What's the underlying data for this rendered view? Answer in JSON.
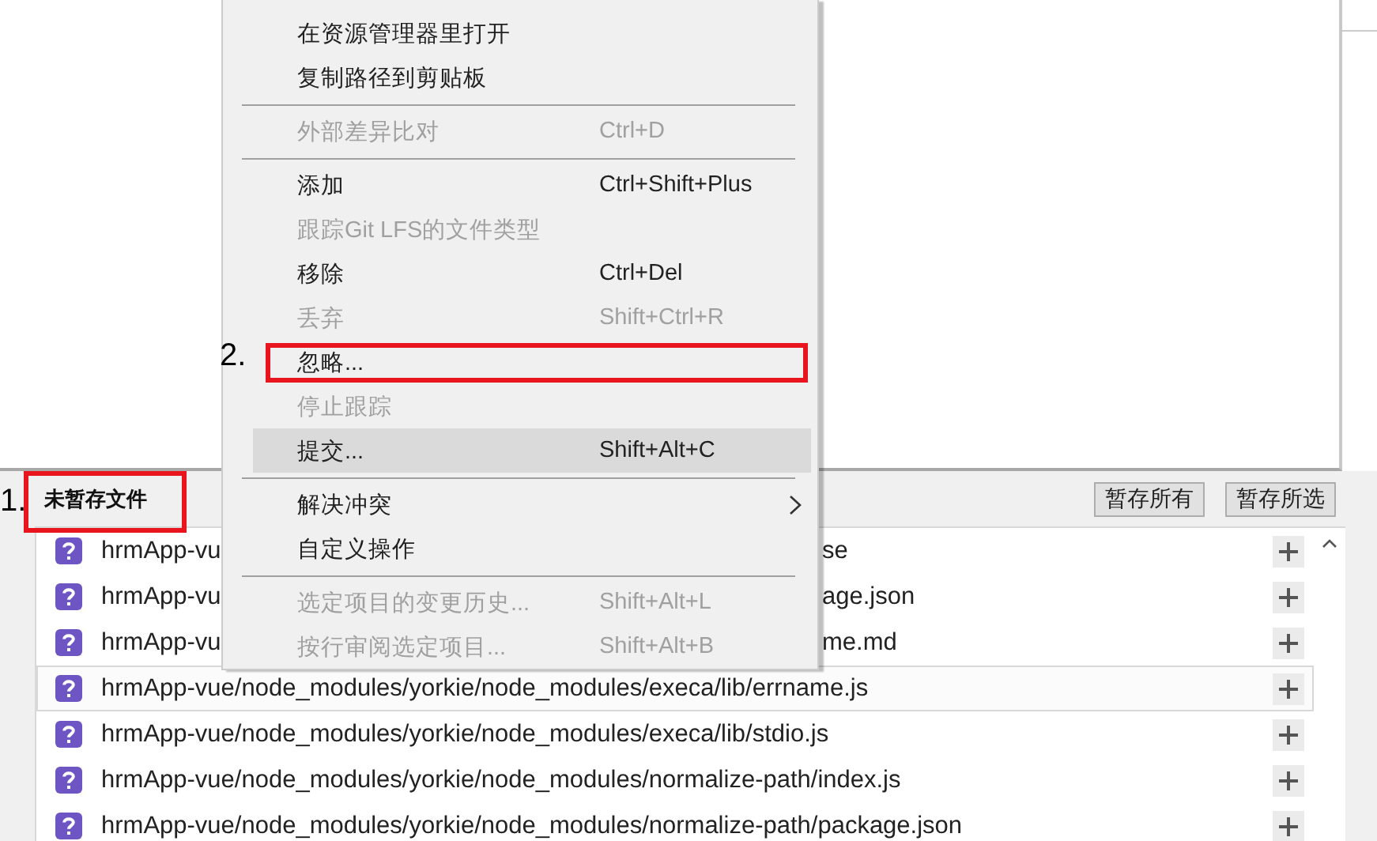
{
  "context_menu": {
    "items": [
      {
        "kind": "item",
        "label": "在资源管理器里打开",
        "disabled": false,
        "selected": false
      },
      {
        "kind": "item",
        "label": "复制路径到剪贴板",
        "disabled": false,
        "selected": false
      },
      {
        "kind": "separator"
      },
      {
        "kind": "item",
        "label": "外部差异比对",
        "shortcut": "Ctrl+D",
        "disabled": true,
        "selected": false
      },
      {
        "kind": "separator"
      },
      {
        "kind": "item",
        "label": "添加",
        "shortcut": "Ctrl+Shift+Plus",
        "disabled": false,
        "selected": false
      },
      {
        "kind": "item",
        "label": "跟踪Git LFS的文件类型",
        "disabled": true,
        "selected": false
      },
      {
        "kind": "item",
        "label": "移除",
        "shortcut": "Ctrl+Del",
        "disabled": false,
        "selected": false
      },
      {
        "kind": "item",
        "label": "丢弃",
        "shortcut": "Shift+Ctrl+R",
        "disabled": true,
        "selected": false
      },
      {
        "kind": "item",
        "label": "忽略...",
        "disabled": false,
        "selected": false
      },
      {
        "kind": "item",
        "label": "停止跟踪",
        "disabled": true,
        "selected": false
      },
      {
        "kind": "item",
        "label": "提交...",
        "shortcut": "Shift+Alt+C",
        "disabled": false,
        "selected": true
      },
      {
        "kind": "separator"
      },
      {
        "kind": "item",
        "label": "解决冲突",
        "disabled": false,
        "selected": false,
        "submenu": true
      },
      {
        "kind": "item",
        "label": "自定义操作",
        "disabled": false,
        "selected": false
      },
      {
        "kind": "separator"
      },
      {
        "kind": "item",
        "label": "选定项目的变更历史...",
        "shortcut": "Shift+Alt+L",
        "disabled": true,
        "selected": false
      },
      {
        "kind": "item",
        "label": "按行审阅选定项目...",
        "shortcut": "Shift+Alt+B",
        "disabled": true,
        "selected": false
      }
    ]
  },
  "unstaged_panel": {
    "title": "未暂存文件",
    "buttons": [
      "暂存所有",
      "暂存所选"
    ],
    "files": [
      {
        "segments": [
          "hrmApp-vu",
          "se"
        ],
        "highlighted": false
      },
      {
        "segments": [
          "hrmApp-vu",
          "age.json"
        ],
        "highlighted": false
      },
      {
        "segments": [
          "hrmApp-vu",
          "me.md"
        ],
        "highlighted": false
      },
      {
        "segments": [
          "hrmApp-vue/node_modules/yorkie/node_modules/execa/lib/errname.js"
        ],
        "highlighted": true
      },
      {
        "segments": [
          "hrmApp-vue/node_modules/yorkie/node_modules/execa/lib/stdio.js"
        ],
        "highlighted": false
      },
      {
        "segments": [
          "hrmApp-vue/node_modules/yorkie/node_modules/normalize-path/index.js"
        ],
        "highlighted": false
      },
      {
        "segments": [
          "hrmApp-vue/node_modules/yorkie/node_modules/normalize-path/package.json"
        ],
        "highlighted": false
      }
    ]
  },
  "annotations": [
    {
      "label": "1."
    },
    {
      "label": "2."
    }
  ]
}
